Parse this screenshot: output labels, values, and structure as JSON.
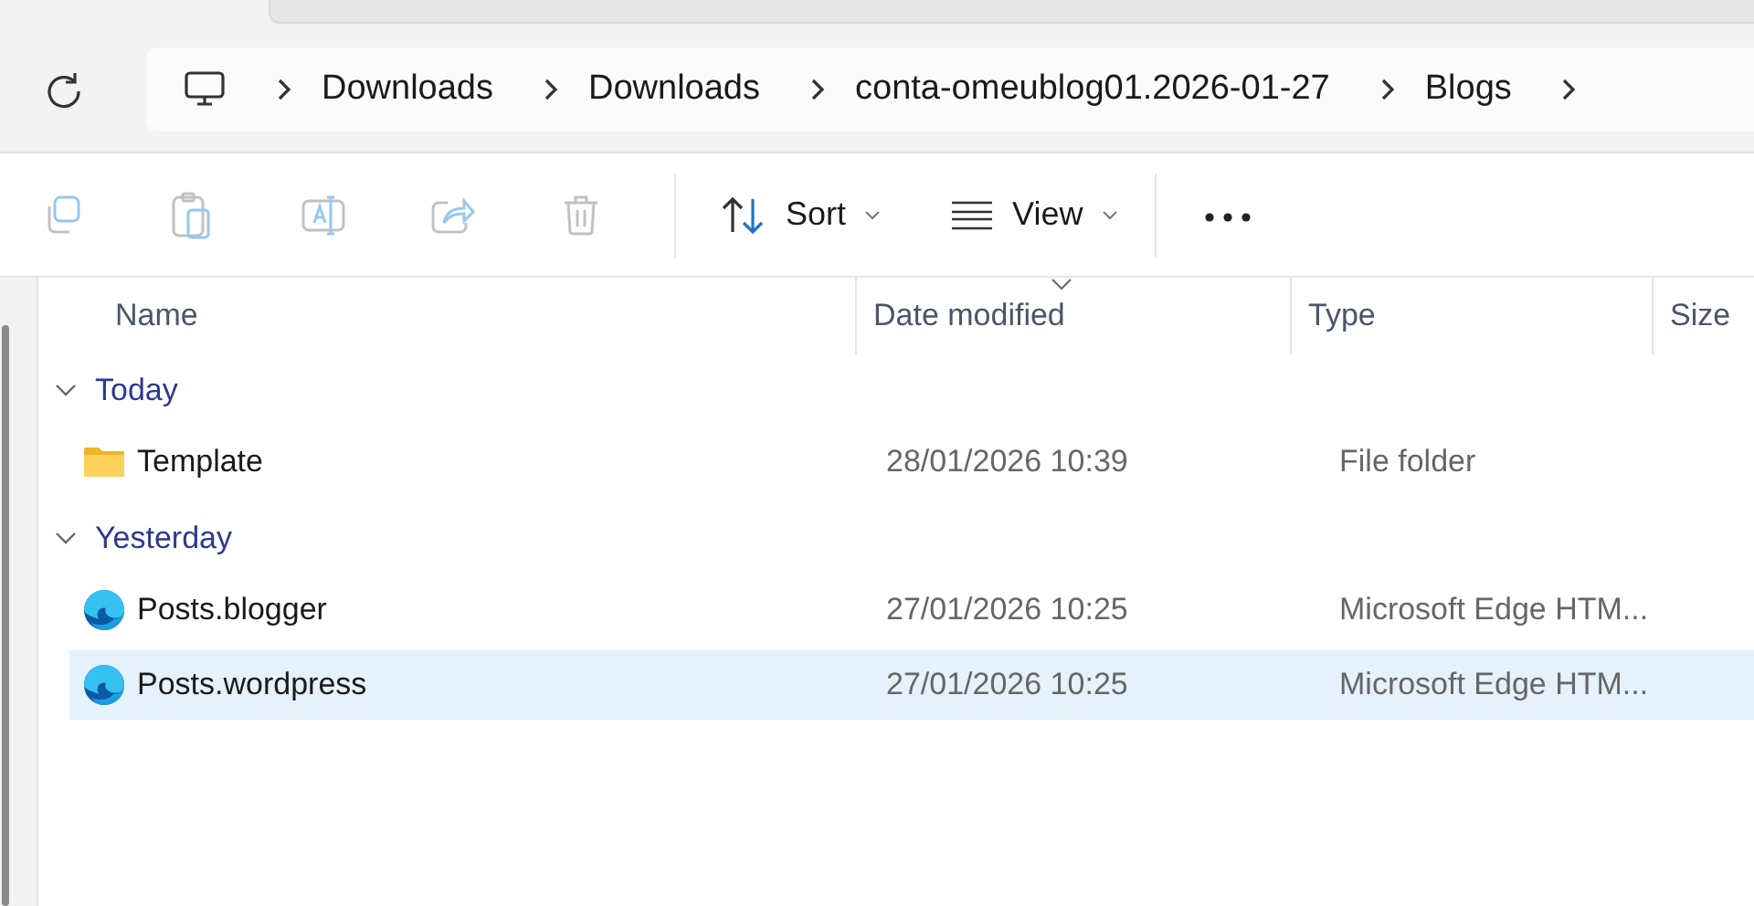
{
  "breadcrumb": {
    "items": [
      "Downloads",
      "Downloads",
      "conta-omeublog01.2026-01-27",
      "Blogs"
    ]
  },
  "toolbar": {
    "actions": [
      {
        "kind": "copy",
        "disabled": true
      },
      {
        "kind": "paste",
        "disabled": true
      },
      {
        "kind": "rename",
        "disabled": true
      },
      {
        "kind": "share",
        "disabled": true
      },
      {
        "kind": "delete",
        "disabled": true
      }
    ],
    "menus": [
      {
        "kind": "sort",
        "label": "Sort"
      },
      {
        "kind": "view",
        "label": "View"
      }
    ]
  },
  "columns": [
    {
      "label": "Name",
      "sorted": false
    },
    {
      "label": "Date modified",
      "sorted": true
    },
    {
      "label": "Type",
      "sorted": false
    },
    {
      "label": "Size",
      "sorted": false
    }
  ],
  "groups": [
    {
      "label": "Today",
      "expanded": true,
      "rows": [
        {
          "kind": "folder",
          "name": "Template",
          "date": "28/01/2026 10:39",
          "type": "File folder",
          "selected": false
        }
      ]
    },
    {
      "label": "Yesterday",
      "expanded": true,
      "rows": [
        {
          "kind": "edge",
          "name": "Posts.blogger",
          "date": "27/01/2026 10:25",
          "type": "Microsoft Edge HTM...",
          "selected": false
        },
        {
          "kind": "edge",
          "name": "Posts.wordpress",
          "date": "27/01/2026 10:25",
          "type": "Microsoft Edge HTM...",
          "selected": true
        }
      ]
    }
  ]
}
